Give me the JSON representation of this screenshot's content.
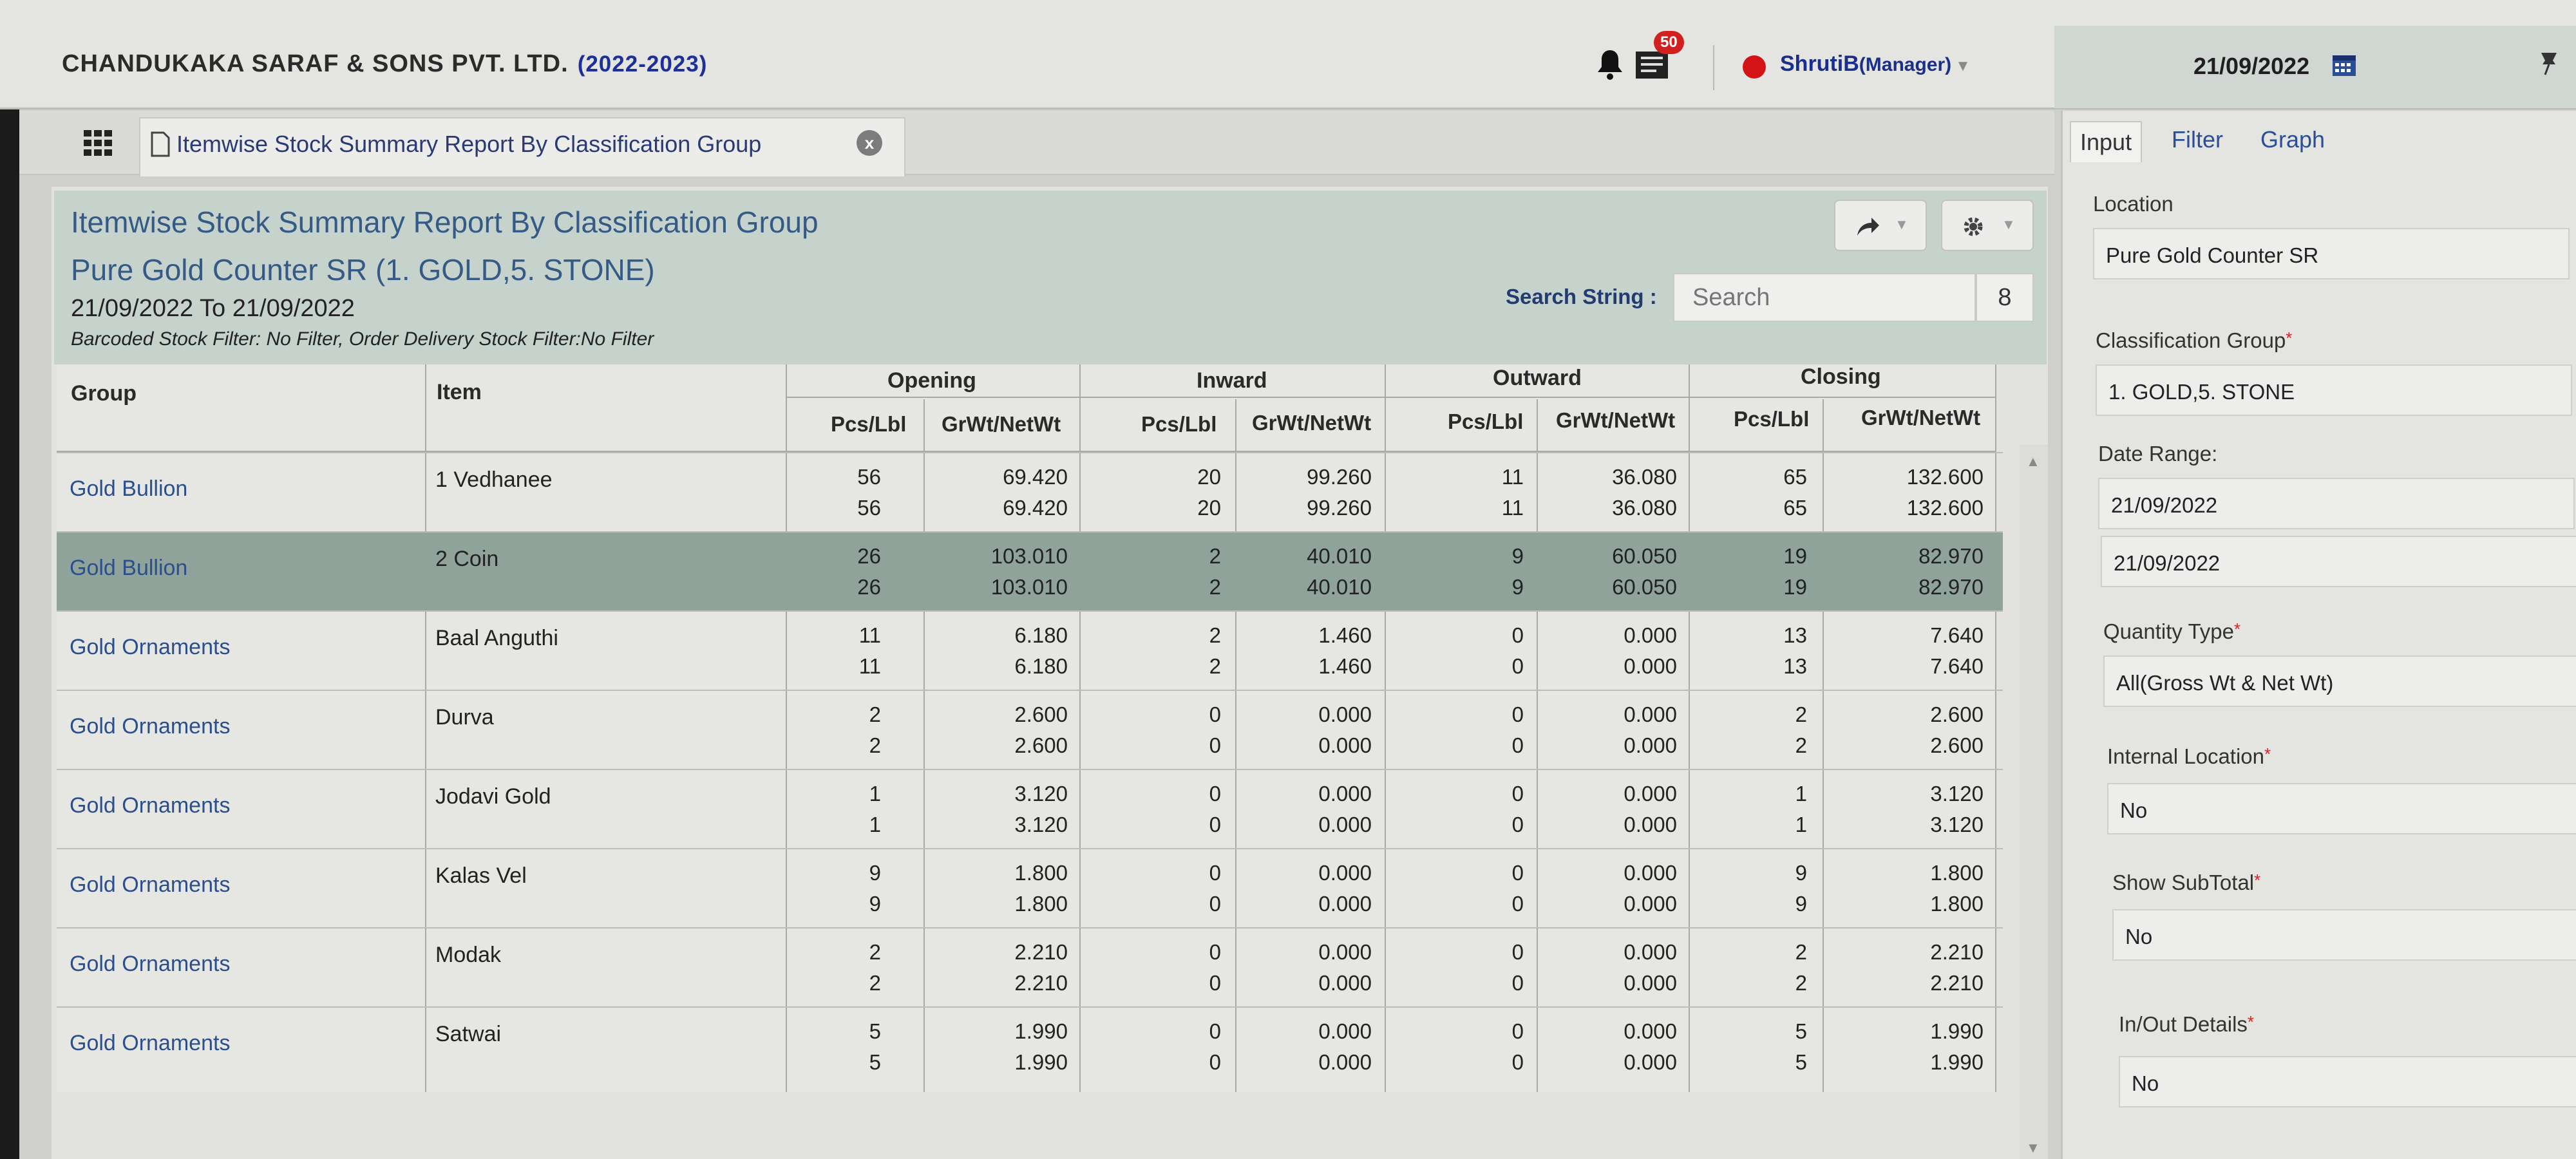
{
  "header": {
    "company": "CHANDUKAKA SARAF & SONS PVT. LTD.",
    "year": "(2022-2023)",
    "notification_count": "50",
    "user_name": "ShrutiB",
    "user_role": "(Manager)",
    "date": "21/09/2022"
  },
  "tab": {
    "title": "Itemwise Stock Summary Report By Classification Group",
    "close": "x"
  },
  "report": {
    "title": "Itemwise Stock Summary Report By Classification Group",
    "subtitle": "Pure Gold Counter SR (1. GOLD,5. STONE)",
    "date_range": "21/09/2022 To 21/09/2022",
    "filter_text": "Barcoded Stock Filter: No Filter, Order Delivery Stock Filter:No Filter",
    "search_label": "Search String :",
    "search_placeholder": "Search",
    "search_count": "8"
  },
  "table": {
    "col_group": "Group",
    "col_item": "Item",
    "sections": [
      "Opening",
      "Inward",
      "Outward",
      "Closing"
    ],
    "sub_pcs": "Pcs/Lbl",
    "sub_wt": "GrWt/NetWt",
    "rows": [
      {
        "group": "Gold Bullion",
        "item": "1 Vedhanee",
        "op_p1": "56",
        "op_p2": "56",
        "op_w1": "69.420",
        "op_w2": "69.420",
        "in_p1": "20",
        "in_p2": "20",
        "in_w1": "99.260",
        "in_w2": "99.260",
        "out_p1": "11",
        "out_p2": "11",
        "out_w1": "36.080",
        "out_w2": "36.080",
        "cl_p1": "65",
        "cl_p2": "65",
        "cl_w1": "132.600",
        "cl_w2": "132.600"
      },
      {
        "group": "Gold Bullion",
        "item": "2 Coin",
        "op_p1": "26",
        "op_p2": "26",
        "op_w1": "103.010",
        "op_w2": "103.010",
        "in_p1": "2",
        "in_p2": "2",
        "in_w1": "40.010",
        "in_w2": "40.010",
        "out_p1": "9",
        "out_p2": "9",
        "out_w1": "60.050",
        "out_w2": "60.050",
        "cl_p1": "19",
        "cl_p2": "19",
        "cl_w1": "82.970",
        "cl_w2": "82.970"
      },
      {
        "group": "Gold Ornaments",
        "item": "Baal Anguthi",
        "op_p1": "11",
        "op_p2": "11",
        "op_w1": "6.180",
        "op_w2": "6.180",
        "in_p1": "2",
        "in_p2": "2",
        "in_w1": "1.460",
        "in_w2": "1.460",
        "out_p1": "0",
        "out_p2": "0",
        "out_w1": "0.000",
        "out_w2": "0.000",
        "cl_p1": "13",
        "cl_p2": "13",
        "cl_w1": "7.640",
        "cl_w2": "7.640"
      },
      {
        "group": "Gold Ornaments",
        "item": "Durva",
        "op_p1": "2",
        "op_p2": "2",
        "op_w1": "2.600",
        "op_w2": "2.600",
        "in_p1": "0",
        "in_p2": "0",
        "in_w1": "0.000",
        "in_w2": "0.000",
        "out_p1": "0",
        "out_p2": "0",
        "out_w1": "0.000",
        "out_w2": "0.000",
        "cl_p1": "2",
        "cl_p2": "2",
        "cl_w1": "2.600",
        "cl_w2": "2.600"
      },
      {
        "group": "Gold Ornaments",
        "item": "Jodavi Gold",
        "op_p1": "1",
        "op_p2": "1",
        "op_w1": "3.120",
        "op_w2": "3.120",
        "in_p1": "0",
        "in_p2": "0",
        "in_w1": "0.000",
        "in_w2": "0.000",
        "out_p1": "0",
        "out_p2": "0",
        "out_w1": "0.000",
        "out_w2": "0.000",
        "cl_p1": "1",
        "cl_p2": "1",
        "cl_w1": "3.120",
        "cl_w2": "3.120"
      },
      {
        "group": "Gold Ornaments",
        "item": "Kalas Vel",
        "op_p1": "9",
        "op_p2": "9",
        "op_w1": "1.800",
        "op_w2": "1.800",
        "in_p1": "0",
        "in_p2": "0",
        "in_w1": "0.000",
        "in_w2": "0.000",
        "out_p1": "0",
        "out_p2": "0",
        "out_w1": "0.000",
        "out_w2": "0.000",
        "cl_p1": "9",
        "cl_p2": "9",
        "cl_w1": "1.800",
        "cl_w2": "1.800"
      },
      {
        "group": "Gold Ornaments",
        "item": "Modak",
        "op_p1": "2",
        "op_p2": "2",
        "op_w1": "2.210",
        "op_w2": "2.210",
        "in_p1": "0",
        "in_p2": "0",
        "in_w1": "0.000",
        "in_w2": "0.000",
        "out_p1": "0",
        "out_p2": "0",
        "out_w1": "0.000",
        "out_w2": "0.000",
        "cl_p1": "2",
        "cl_p2": "2",
        "cl_w1": "2.210",
        "cl_w2": "2.210"
      },
      {
        "group": "Gold Ornaments",
        "item": "Satwai",
        "op_p1": "5",
        "op_p2": "5",
        "op_w1": "1.990",
        "op_w2": "1.990",
        "in_p1": "0",
        "in_p2": "0",
        "in_w1": "0.000",
        "in_w2": "0.000",
        "out_p1": "0",
        "out_p2": "0",
        "out_w1": "0.000",
        "out_w2": "0.000",
        "cl_p1": "5",
        "cl_p2": "5",
        "cl_w1": "1.990",
        "cl_w2": "1.990"
      }
    ]
  },
  "panel": {
    "tabs": [
      "Input",
      "Filter",
      "Graph"
    ],
    "location_label": "Location",
    "location_value": "Pure Gold Counter SR",
    "classification_label": "Classification Group",
    "classification_value": "1. GOLD,5. STONE",
    "date_range_label": "Date Range:",
    "date_from": "21/09/2022",
    "date_to": "21/09/2022",
    "quantity_label": "Quantity Type",
    "quantity_value": "All(Gross Wt & Net Wt)",
    "internal_label": "Internal Location",
    "internal_value": "No",
    "subtotal_label": "Show SubTotal",
    "subtotal_value": "No",
    "inout_label": "In/Out Details",
    "inout_value": "No",
    "required_mark": "*"
  },
  "colors": {
    "link_blue": "#2b4f8c",
    "header_teal": "#c6d3cc",
    "selected_row": "#8fa39b",
    "alert_red": "#d21f1f"
  }
}
